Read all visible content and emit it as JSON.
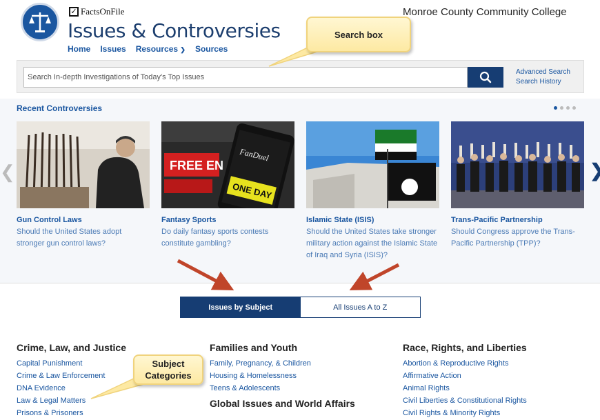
{
  "header": {
    "brand": "FactsOnFile",
    "title": "Issues & Controversies",
    "institution": "Monroe County Community College",
    "nav": [
      "Home",
      "Issues",
      "Resources",
      "Sources"
    ]
  },
  "search": {
    "placeholder": "Search In-depth Investigations of Today's Top Issues",
    "advanced": "Advanced Search",
    "history": "Search History"
  },
  "recent": {
    "title": "Recent Controversies",
    "cards": [
      {
        "title": "Gun Control Laws",
        "desc": "Should the United States adopt stronger gun control laws?"
      },
      {
        "title": "Fantasy Sports",
        "desc": "Do daily fantasy sports contests constitute gambling?"
      },
      {
        "title": "Islamic State (ISIS)",
        "desc": "Should the United States take stronger military action against the Islamic State of Iraq and Syria (ISIS)?"
      },
      {
        "title": "Trans-Pacific Partnership",
        "desc": "Should Congress approve the Trans-Pacific Partnership (TPP)?"
      }
    ]
  },
  "browse_tabs": {
    "by_subject": "Issues by Subject",
    "a_to_z": "All Issues A to Z"
  },
  "subjects": {
    "col1": {
      "heading": "Crime, Law, and Justice",
      "items": [
        "Capital Punishment",
        "Crime & Law Enforcement",
        "DNA Evidence",
        "Law & Legal Matters",
        "Prisons & Prisoners"
      ]
    },
    "col2": {
      "heading": "Families and Youth",
      "items": [
        "Family, Pregnancy, & Children",
        "Housing & Homelessness",
        "Teens & Adolescents"
      ],
      "heading2": "Global Issues and World Affairs"
    },
    "col3": {
      "heading": "Race, Rights, and Liberties",
      "items": [
        "Abortion & Reproductive Rights",
        "Affirmative Action",
        "Animal Rights",
        "Civil Liberties & Constitutional Rights",
        "Civil Rights & Minority Rights"
      ]
    }
  },
  "annotations": {
    "search": "Search box",
    "subjects_line1": "Subject",
    "subjects_line2": "Categories"
  },
  "colors": {
    "brand_blue": "#163d73",
    "link_blue": "#1a56a0",
    "callout": "#fde9a3",
    "arrow_red": "#c0452a"
  }
}
